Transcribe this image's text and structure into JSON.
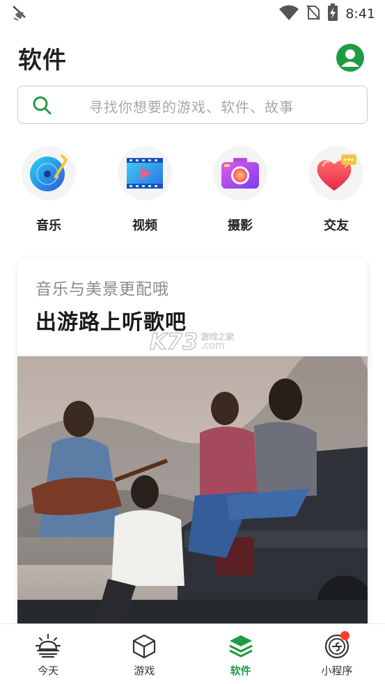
{
  "status_bar": {
    "time": "8:41",
    "icons": [
      "app-notification-icon",
      "wifi-icon",
      "no-sim-icon",
      "battery-charging-icon"
    ]
  },
  "header": {
    "title": "软件",
    "avatar_icon": "user-avatar-icon"
  },
  "search": {
    "placeholder": "寻找你想要的游戏、软件、故事",
    "icon": "search-icon"
  },
  "categories": [
    {
      "label": "音乐",
      "icon": "music-disc-icon"
    },
    {
      "label": "视频",
      "icon": "film-play-icon"
    },
    {
      "label": "摄影",
      "icon": "camera-icon"
    },
    {
      "label": "交友",
      "icon": "heart-chat-icon"
    }
  ],
  "card": {
    "subtitle": "音乐与美景更配哦",
    "title": "出游路上听歌吧",
    "watermark_main": "K73",
    "watermark_cn": "游戏之家",
    "watermark_com": ".com",
    "photo": "friends-on-pickup-truck-photo"
  },
  "bottom_nav": [
    {
      "label": "今天",
      "icon": "today-sun-icon",
      "active": false
    },
    {
      "label": "游戏",
      "icon": "cube-icon",
      "active": false
    },
    {
      "label": "软件",
      "icon": "layers-icon",
      "active": true
    },
    {
      "label": "小程序",
      "icon": "mini-program-icon",
      "active": false,
      "badge": true
    }
  ],
  "colors": {
    "accent": "#1f9b44",
    "badge": "#ff3b30",
    "placeholder": "#a8a8a8"
  }
}
